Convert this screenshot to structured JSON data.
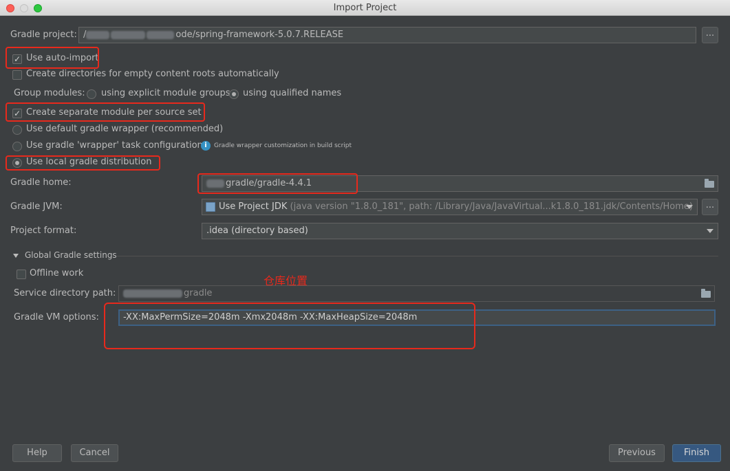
{
  "window": {
    "title": "Import Project"
  },
  "gradle_project": {
    "label": "Gradle project:",
    "value": "/spring-framework-5.0.7.RELEASE",
    "value_display_suffix": "ode/spring-framework-5.0.7.RELEASE",
    "browse_label": "..."
  },
  "options": {
    "auto_import": {
      "label": "Use auto-import",
      "checked": true
    },
    "create_dirs": {
      "label": "Create directories for empty content roots automatically",
      "checked": false
    },
    "group_modules": {
      "label": "Group modules:",
      "explicit": "using explicit module groups",
      "qualified": "using qualified names",
      "selected": "qualified"
    },
    "separate_module": {
      "label": "Create separate module per source set",
      "checked": true
    },
    "default_wrapper": {
      "label": "Use default gradle wrapper (recommended)"
    },
    "wrapper_task": {
      "label": "Use gradle 'wrapper' task configuration",
      "hint": "Gradle wrapper customization in build script"
    },
    "local_distribution": {
      "label": "Use local gradle distribution",
      "selected": true
    }
  },
  "gradle_home": {
    "label": "Gradle home:",
    "value": "gradle/gradle-4.4.1"
  },
  "gradle_jvm": {
    "label": "Gradle JVM:",
    "value": "Use Project JDK",
    "detail": "(java version \"1.8.0_181\", path: /Library/Java/JavaVirtual...k1.8.0_181.jdk/Contents/Home)",
    "browse_label": "..."
  },
  "project_format": {
    "label": "Project format:",
    "value": ".idea (directory based)"
  },
  "global_settings": {
    "header": "Global Gradle settings",
    "offline": {
      "label": "Offline work",
      "checked": false
    },
    "service_dir": {
      "label": "Service directory path:",
      "value": "gradle"
    },
    "vm_options": {
      "label": "Gradle VM options:",
      "value": "-XX:MaxPermSize=2048m -Xmx2048m -XX:MaxHeapSize=2048m"
    }
  },
  "annotation": {
    "text": "仓库位置"
  },
  "buttons": {
    "help": "Help",
    "cancel": "Cancel",
    "previous": "Previous",
    "finish": "Finish"
  },
  "colors": {
    "background": "#3c3f41",
    "highlight": "#e8291c",
    "primary": "#365880"
  }
}
